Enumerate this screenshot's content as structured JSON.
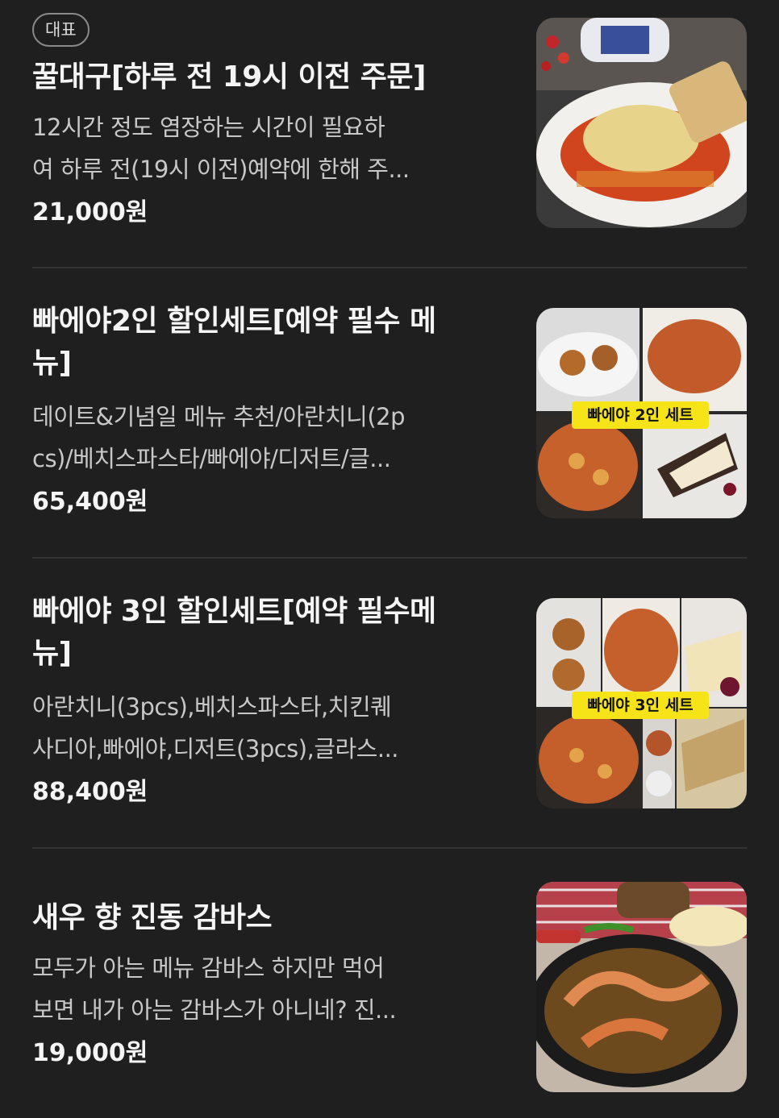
{
  "items": [
    {
      "badge": "대표",
      "title_lines": [
        "꿀대구[하루 전 19시 이전 주문]"
      ],
      "desc_lines": [
        "12시간 정도 염장하는 시간이 필요하",
        "여 하루 전(19시 이전)예약에 한해 주..."
      ],
      "price": "21,000원",
      "image": "baked-cod-dish"
    },
    {
      "title_lines": [
        "빠에야2인 할인세트[예약 필수 메",
        "뉴]"
      ],
      "desc_lines": [
        "데이트&기념일 메뉴 추천/아란치니(2p",
        "cs)/베치스파스타/빠에야/디저트/글..."
      ],
      "price": "65,400원",
      "image": "paella-2-set-collage",
      "image_label": "빠에야 2인 세트"
    },
    {
      "title_lines": [
        "빠에야 3인 할인세트[예약 필수메",
        "뉴]"
      ],
      "desc_lines": [
        "아란치니(3pcs),베치스파스타,치킨퀘",
        "사디아,빠에야,디저트(3pcs),글라스..."
      ],
      "price": "88,400원",
      "image": "paella-3-set-collage",
      "image_label": "빠에야 3인 세트"
    },
    {
      "title_lines": [
        "새우 향 진동 감바스"
      ],
      "desc_lines": [
        "모두가 아는 메뉴 감바스 하지만 먹어",
        "보면 내가 아는 감바스가 아니네? 진..."
      ],
      "price": "19,000원",
      "image": "gambas-skillet"
    }
  ],
  "colors": {
    "background": "#1f1f1f",
    "divider": "#333333",
    "label_yellow": "#f7e418"
  }
}
